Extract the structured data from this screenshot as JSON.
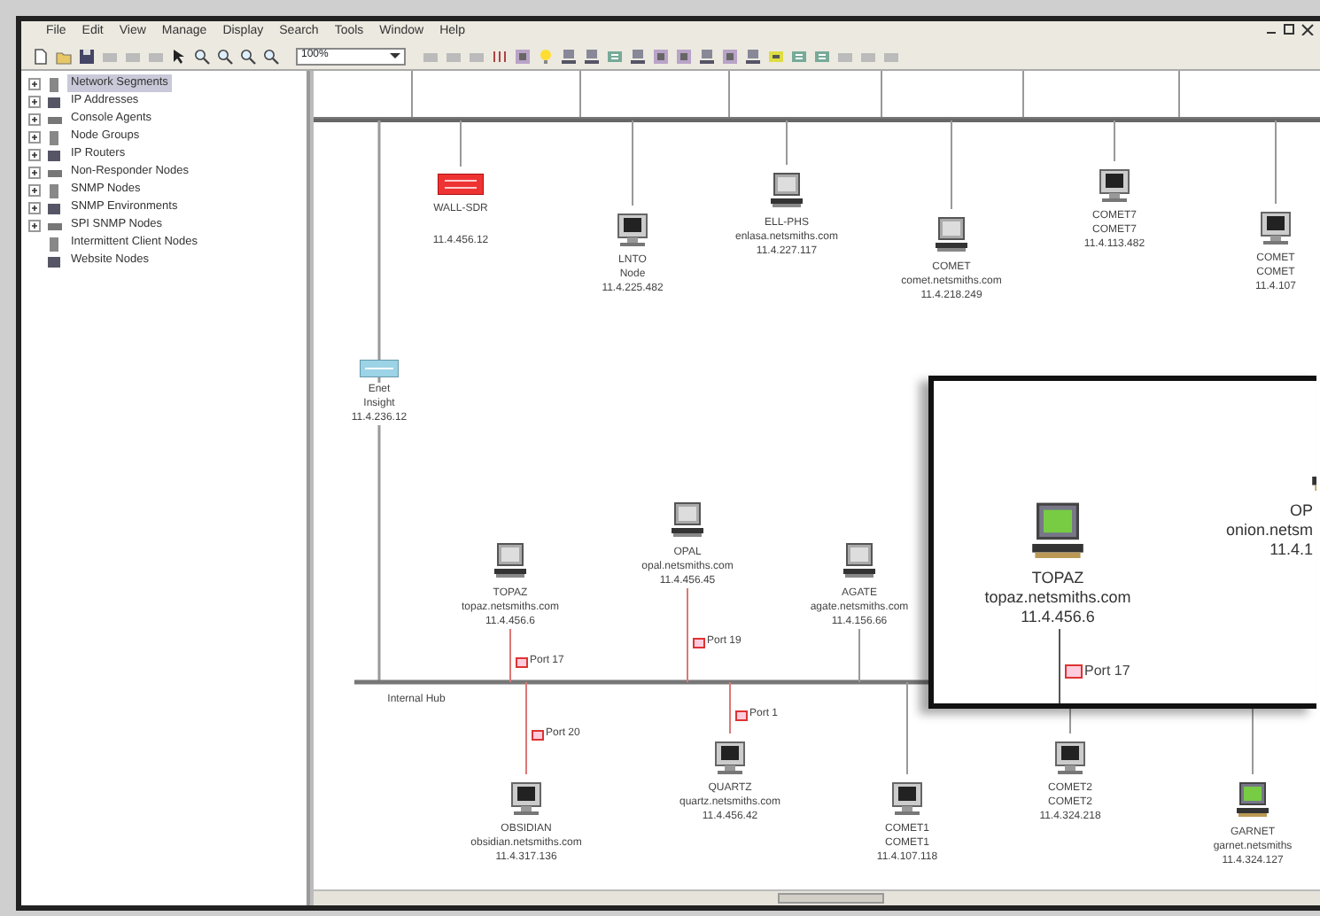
{
  "menu": [
    "File",
    "Edit",
    "View",
    "Manage",
    "Display",
    "Search",
    "Tools",
    "Window",
    "Help"
  ],
  "toolbar": {
    "zoom": "100%"
  },
  "tree": {
    "items": [
      {
        "label": "Network Segments",
        "selected": true,
        "expanded": false
      },
      {
        "label": "IP Addresses",
        "selected": false,
        "expanded": false
      },
      {
        "label": "Console Agents",
        "selected": false,
        "expanded": false
      },
      {
        "label": "Node Groups",
        "selected": false,
        "expanded": false
      },
      {
        "label": "IP Routers",
        "selected": false,
        "expanded": false
      },
      {
        "label": "Non-Responder Nodes",
        "selected": false,
        "expanded": false
      },
      {
        "label": "SNMP Nodes",
        "selected": false,
        "expanded": false
      },
      {
        "label": "SNMP Environments",
        "selected": false,
        "expanded": false
      },
      {
        "label": "SPI SNMP Nodes",
        "selected": false,
        "expanded": false
      },
      {
        "label": "Intermittent Client Nodes",
        "selected": false
      },
      {
        "label": "Website Nodes",
        "selected": false
      }
    ]
  },
  "diagram": {
    "nodes": [
      {
        "kind": "router",
        "labels": [
          "WALL-SDR",
          "11.4.456.12"
        ]
      },
      {
        "kind": "server",
        "labels": [
          "LNTO",
          "Node",
          "11.4.225.482"
        ]
      },
      {
        "kind": "terminal",
        "labels": [
          "ELL-PHS",
          "enlasa.netsmiths.com",
          "11.4.227.117"
        ]
      },
      {
        "kind": "terminal",
        "labels": [
          "COMET",
          "comet.netsmiths.com",
          "11.4.218.249"
        ]
      },
      {
        "kind": "server",
        "labels": [
          "COMET7",
          "COMET7",
          "11.4.113.482"
        ]
      },
      {
        "kind": "server",
        "labels": [
          "COMET",
          "COMET",
          "11.4.107"
        ]
      },
      {
        "kind": "hub",
        "labels": [
          "Enet",
          "Insight",
          "11.4.236.12"
        ]
      },
      {
        "kind": "terminal",
        "labels": [
          "TOPAZ",
          "topaz.netsmiths.com",
          "11.4.456.6"
        ],
        "port": "Port 17"
      },
      {
        "kind": "terminal",
        "labels": [
          "OPAL",
          "opal.netsmiths.com",
          "11.4.456.45"
        ],
        "port": "Port 19"
      },
      {
        "kind": "terminal",
        "labels": [
          "AGATE",
          "agate.netsmiths.com",
          "11.4.156.66"
        ]
      },
      {
        "kind": "server",
        "labels": [
          "OBSIDIAN",
          "obsidian.netsmiths.com",
          "11.4.317.136"
        ],
        "port": "Port 20"
      },
      {
        "kind": "server",
        "labels": [
          "QUARTZ",
          "quartz.netsmiths.com",
          "11.4.456.42"
        ],
        "port": "Port 1"
      },
      {
        "kind": "server",
        "labels": [
          "COMET1",
          "COMET1",
          "11.4.107.118"
        ]
      },
      {
        "kind": "server",
        "labels": [
          "COMET2",
          "COMET2",
          "11.4.324.218"
        ]
      },
      {
        "kind": "workstation",
        "labels": [
          "GARNET",
          "garnet.netsmiths",
          "11.4.324.127"
        ]
      }
    ],
    "bus_label": "Internal Hub",
    "inset": {
      "nodes": [
        {
          "kind": "workstation",
          "labels": [
            "TOPAZ",
            "topaz.netsmiths.com",
            "11.4.456.6"
          ],
          "port": "Port 17"
        },
        {
          "kind": "workstation",
          "labels": [
            "OP",
            "onion.netsm",
            "11.4.1"
          ]
        }
      ]
    }
  }
}
